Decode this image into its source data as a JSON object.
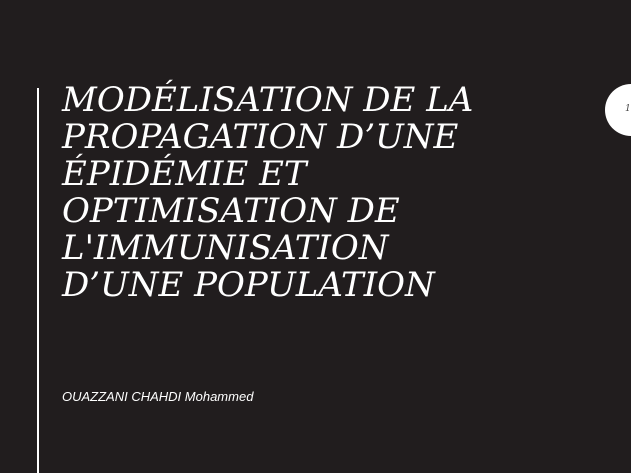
{
  "slide": {
    "title_lines": [
      "MODÉLISATION DE LA",
      "PROPAGATION D’UNE",
      "ÉPIDÉMIE ET",
      "OPTIMISATION DE",
      "L'IMMUNISATION",
      "D’UNE POPULATION"
    ],
    "author": "OUAZZANI CHAHDI Mohammed",
    "page_number": "1"
  },
  "colors": {
    "background": "#211d1e",
    "text": "#ffffff",
    "accent_line": "#ffffff",
    "page_badge": "#ffffff"
  }
}
